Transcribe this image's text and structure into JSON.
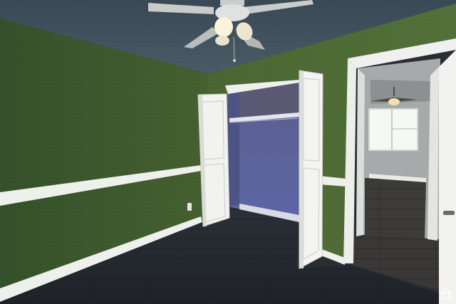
{
  "scene": {
    "kind": "photo-empty-bedroom",
    "colors": {
      "wall_left": "#3f5a2e",
      "wall_right": "#4c6a34",
      "ceiling": "#3c4d58",
      "closet_interior": "#5c6298",
      "floor": "#262a31",
      "trim": "#eef0ec",
      "hall_wall": "#9a9d9e",
      "hall_floor": "#3a3a3a",
      "window_light": "#f4f6f2"
    },
    "icons": [
      "ceiling-fan-icon",
      "ceiling-fan-icon",
      "closet-door-icon",
      "closet-door-icon",
      "window-icon",
      "outlet-icon",
      "house-watermark-icon"
    ]
  }
}
